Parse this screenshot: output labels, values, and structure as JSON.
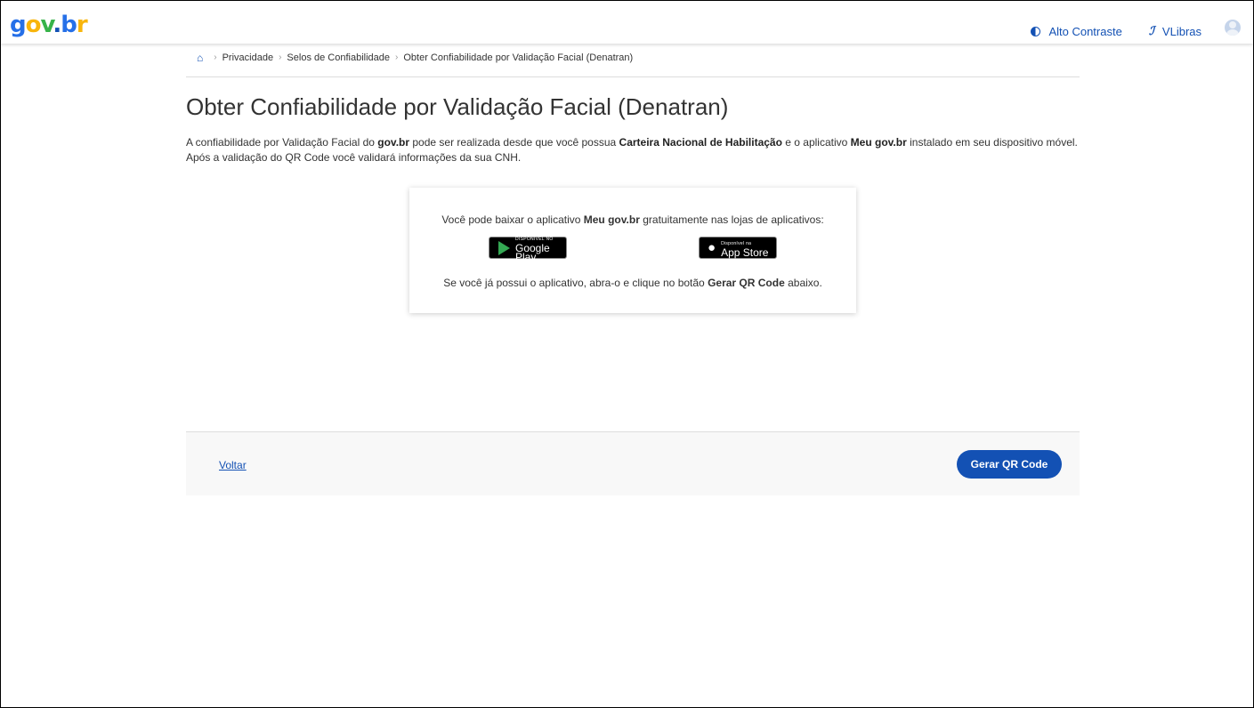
{
  "header": {
    "logo": {
      "g": "g",
      "o": "o",
      "v": "v",
      "dot": ".",
      "b": "b",
      "r": "r"
    },
    "links": {
      "contrast": "Alto Contraste",
      "vlibras": "VLibras"
    }
  },
  "breadcrumb": {
    "items": [
      "Privacidade",
      "Selos de Confiabilidade",
      "Obter Confiabilidade por Validação Facial (Denatran)"
    ]
  },
  "page": {
    "title": "Obter Confiabilidade por Validação Facial (Denatran)",
    "intro": {
      "p1": "A confiabilidade por Validação Facial do ",
      "b1": "gov.br",
      "p2": " pode ser realizada desde que você possua ",
      "b2": "Carteira Nacional de Habilitação",
      "p3": " e o aplicativo ",
      "b3": "Meu gov.br",
      "p4": " instalado em seu dispositivo móvel. Após a validação do QR Code você validará informações da sua CNH."
    }
  },
  "card": {
    "line1_a": "Você pode baixar o aplicativo ",
    "line1_b": "Meu gov.br",
    "line1_c": " gratuitamente nas lojas de aplicativos:",
    "google_small": "DISPONÍVEL NO",
    "google_big": "Google Play",
    "apple_small": "Disponível na",
    "apple_big": "App Store",
    "line2_a": "Se você já possui o aplicativo, abra-o e clique no botão ",
    "line2_b": "Gerar QR Code",
    "line2_c": " abaixo."
  },
  "footer": {
    "back": "Voltar",
    "generate": "Gerar QR Code"
  }
}
